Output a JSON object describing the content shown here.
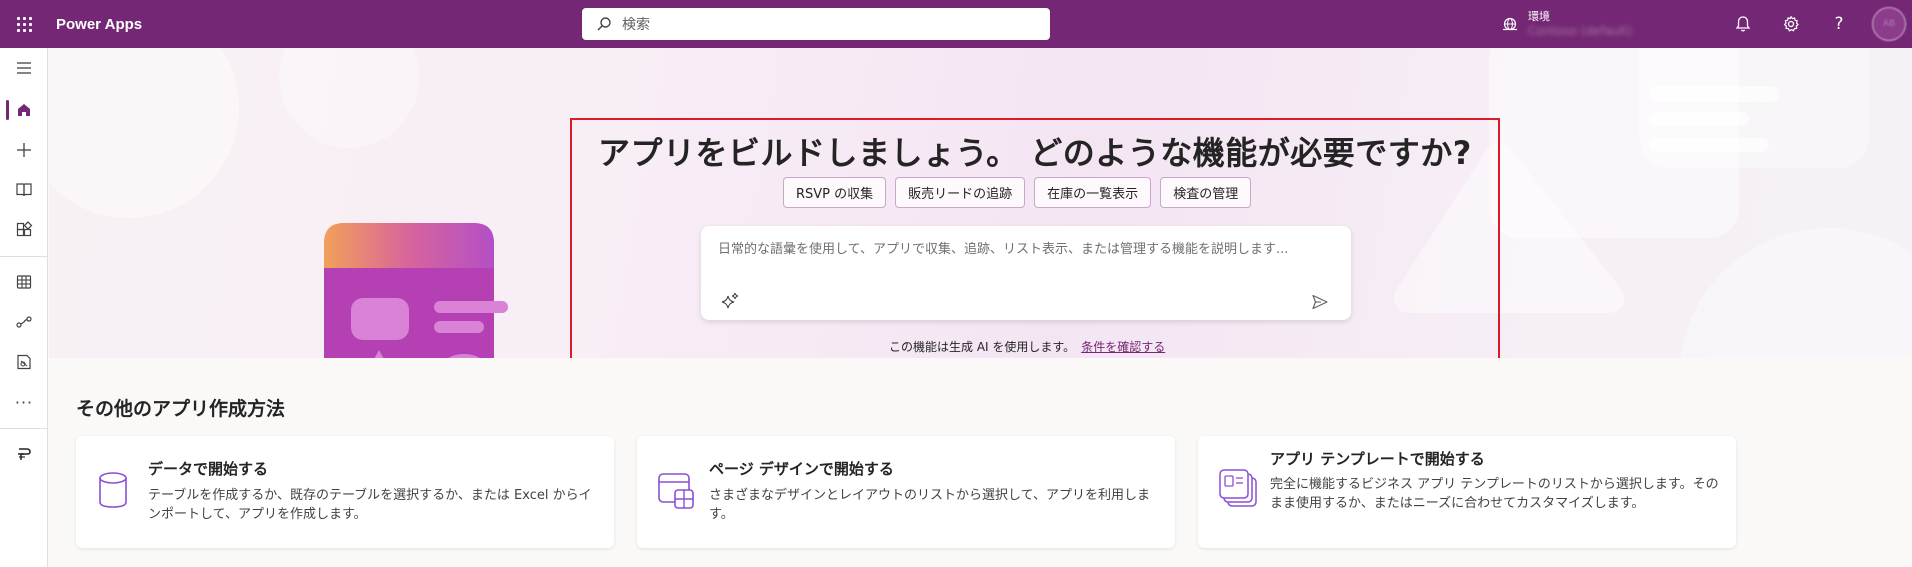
{
  "topbar": {
    "app_title": "Power Apps",
    "search_placeholder": "検索",
    "environment_label": "環境",
    "environment_value": "Contoso (default)",
    "avatar_initials": "AB"
  },
  "hero": {
    "title": "アプリをビルドしましょう。 どのような機能が必要ですか?",
    "chips": [
      "RSVP の収集",
      "販売リードの追跡",
      "在庫の一覧表示",
      "検査の管理"
    ],
    "prompt_placeholder": "日常的な語彙を使用して、アプリで収集、追跡、リスト表示、または管理する機能を説明します...",
    "ai_note": "この機能は生成 AI を使用します。",
    "ai_link": "条件を確認する"
  },
  "other_methods": {
    "title": "その他のアプリ作成方法",
    "cards": [
      {
        "title": "データで開始する",
        "description": "テーブルを作成するか、既存のテーブルを選択するか、または Excel からインポートして、アプリを作成します。",
        "icon": "database-icon"
      },
      {
        "title": "ページ デザインで開始する",
        "description": "さまざまなデザインとレイアウトのリストから選択して、アプリを利用します。",
        "icon": "page-design-icon"
      },
      {
        "title": "アプリ テンプレートで開始する",
        "description": "完全に機能するビジネス アプリ テンプレートのリストから選択します。そのまま使用するか、またはニーズに合わせてカスタマイズします。",
        "icon": "template-icon"
      }
    ]
  },
  "rail": {
    "items": [
      "menu-icon",
      "home-icon",
      "create-icon",
      "learn-icon",
      "apps-icon",
      "tables-icon",
      "flows-icon",
      "solutions-icon",
      "more-icon",
      "power-platform-icon"
    ]
  },
  "colors": {
    "brand": "#742774",
    "highlight_frame": "#e0192a"
  }
}
